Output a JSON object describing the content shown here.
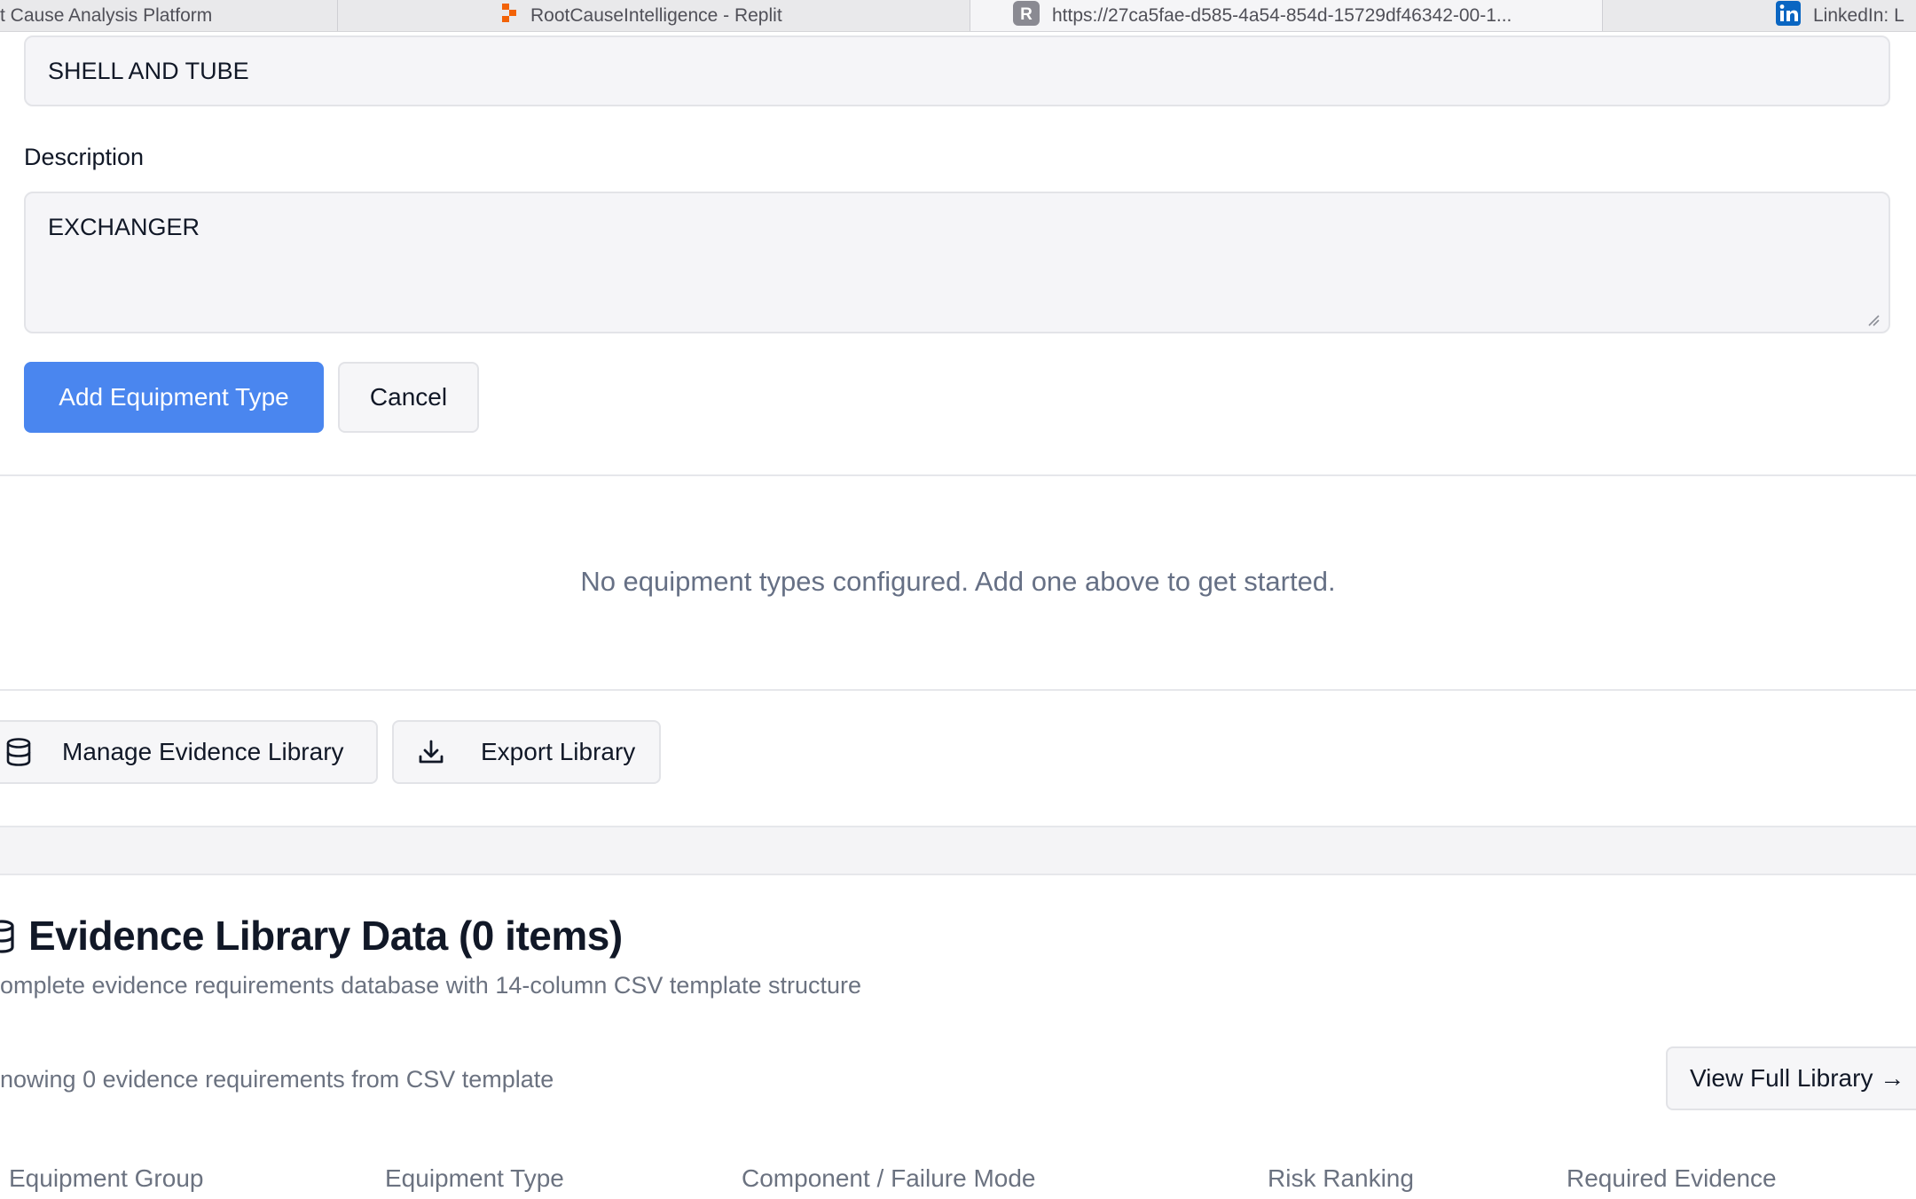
{
  "browser": {
    "tabs": [
      {
        "title": "t Cause Analysis Platform",
        "active": false
      },
      {
        "title": "RootCauseIntelligence - Replit",
        "active": false
      },
      {
        "title": "https://27ca5fae-d585-4a54-854d-15729df46342-00-1...",
        "active": true
      },
      {
        "title": "LinkedIn: L",
        "active": false
      }
    ]
  },
  "form": {
    "name_value": "SHELL AND TUBE",
    "description_label": "Description",
    "description_value": "EXCHANGER",
    "add_button": "Add Equipment Type",
    "cancel_button": "Cancel"
  },
  "equipment_types": {
    "empty_message": "No equipment types configured. Add one above to get started."
  },
  "toolbar": {
    "manage_button": "Manage Evidence Library",
    "export_button": "Export Library"
  },
  "evidence_library": {
    "title": "Evidence Library Data (0 items)",
    "subtitle": "omplete evidence requirements database with 14-column CSV template structure",
    "showing_text": "nowing 0 evidence requirements from CSV template",
    "view_full_button": "View Full Library →",
    "columns": [
      "Equipment Group",
      "Equipment Type",
      "Component / Failure Mode",
      "Risk Ranking",
      "Required Evidence"
    ]
  },
  "colors": {
    "primary": "#4a86ef",
    "muted_text": "#6b7280",
    "input_bg": "#f5f5f8"
  }
}
